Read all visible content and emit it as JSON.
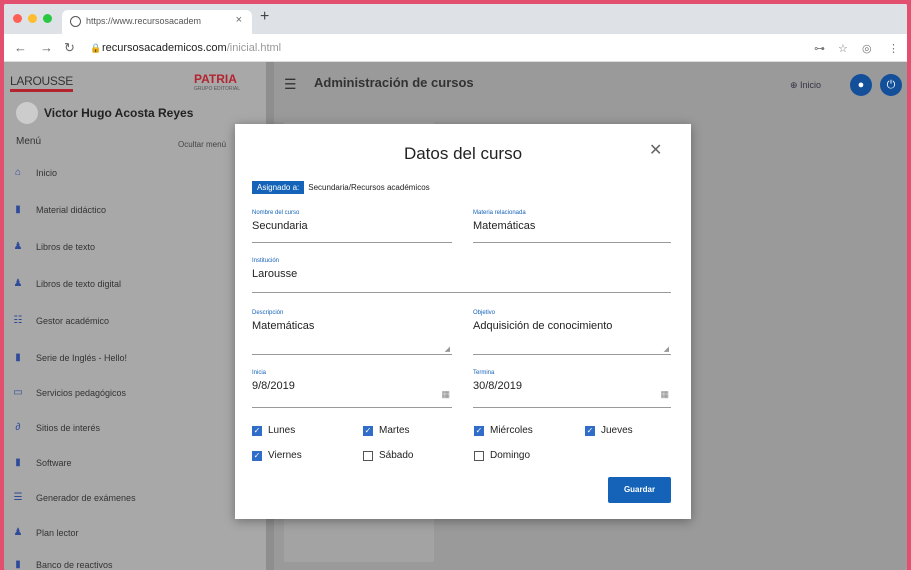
{
  "browser": {
    "tab_title": "https://www.recursosacadem",
    "url_host": "recursosacademicos.com",
    "url_path": "/inicial.html",
    "controls": {
      "dot_red": "#ff5f57",
      "dot_yellow": "#febc2e",
      "dot_green": "#28c840"
    }
  },
  "sidebar": {
    "logo_left": "LAROUSSE",
    "logo_right": "PATRIA",
    "logo_right_sub": "GRUPO EDITORIAL",
    "user_name": "Victor Hugo Acosta Reyes",
    "menu_label": "Menú",
    "hide_menu": "Ocultar menú",
    "items": [
      {
        "label": "Inicio",
        "icon": "home-icon"
      },
      {
        "label": "Material didáctico",
        "icon": "book-icon"
      },
      {
        "label": "Libros de texto",
        "icon": "books-icon"
      },
      {
        "label": "Libros de texto digital",
        "icon": "digital-books-icon"
      },
      {
        "label": "Gestor académico",
        "icon": "people-icon"
      },
      {
        "label": "Serie de Inglés - Hello!",
        "icon": "book-icon"
      },
      {
        "label": "Servicios pedagógicos",
        "icon": "chat-icon"
      },
      {
        "label": "Sitios de interés",
        "icon": "link-icon"
      },
      {
        "label": "Software",
        "icon": "software-icon"
      },
      {
        "label": "Generador de exámenes",
        "icon": "list-icon"
      },
      {
        "label": "Plan lector",
        "icon": "reader-icon"
      },
      {
        "label": "Banco de reactivos",
        "icon": "bank-icon"
      }
    ]
  },
  "header": {
    "title": "Administración de cursos",
    "inicio": "Inicio"
  },
  "modal": {
    "title": "Datos del curso",
    "assigned_label": "Asignado a:",
    "assigned_value": "Secundaria/Recursos académicos",
    "fields": {
      "course_name": {
        "label": "Nombre del curso",
        "value": "Secundaria"
      },
      "subject": {
        "label": "Materia relacionada",
        "value": "Matemáticas"
      },
      "institution": {
        "label": "Institución",
        "value": "Larousse"
      },
      "description": {
        "label": "Descripción",
        "value": "Matemáticas"
      },
      "objective": {
        "label": "Objetivo",
        "value": "Adquisición de conocimiento"
      },
      "start": {
        "label": "Inicia",
        "value": "9/8/2019"
      },
      "end": {
        "label": "Termina",
        "value": "30/8/2019"
      }
    },
    "days": [
      {
        "label": "Lunes",
        "checked": true
      },
      {
        "label": "Martes",
        "checked": true
      },
      {
        "label": "Miércoles",
        "checked": true
      },
      {
        "label": "Jueves",
        "checked": true
      },
      {
        "label": "Viernes",
        "checked": true
      },
      {
        "label": "Sábado",
        "checked": false
      },
      {
        "label": "Domingo",
        "checked": false
      }
    ],
    "save_label": "Guardar"
  }
}
